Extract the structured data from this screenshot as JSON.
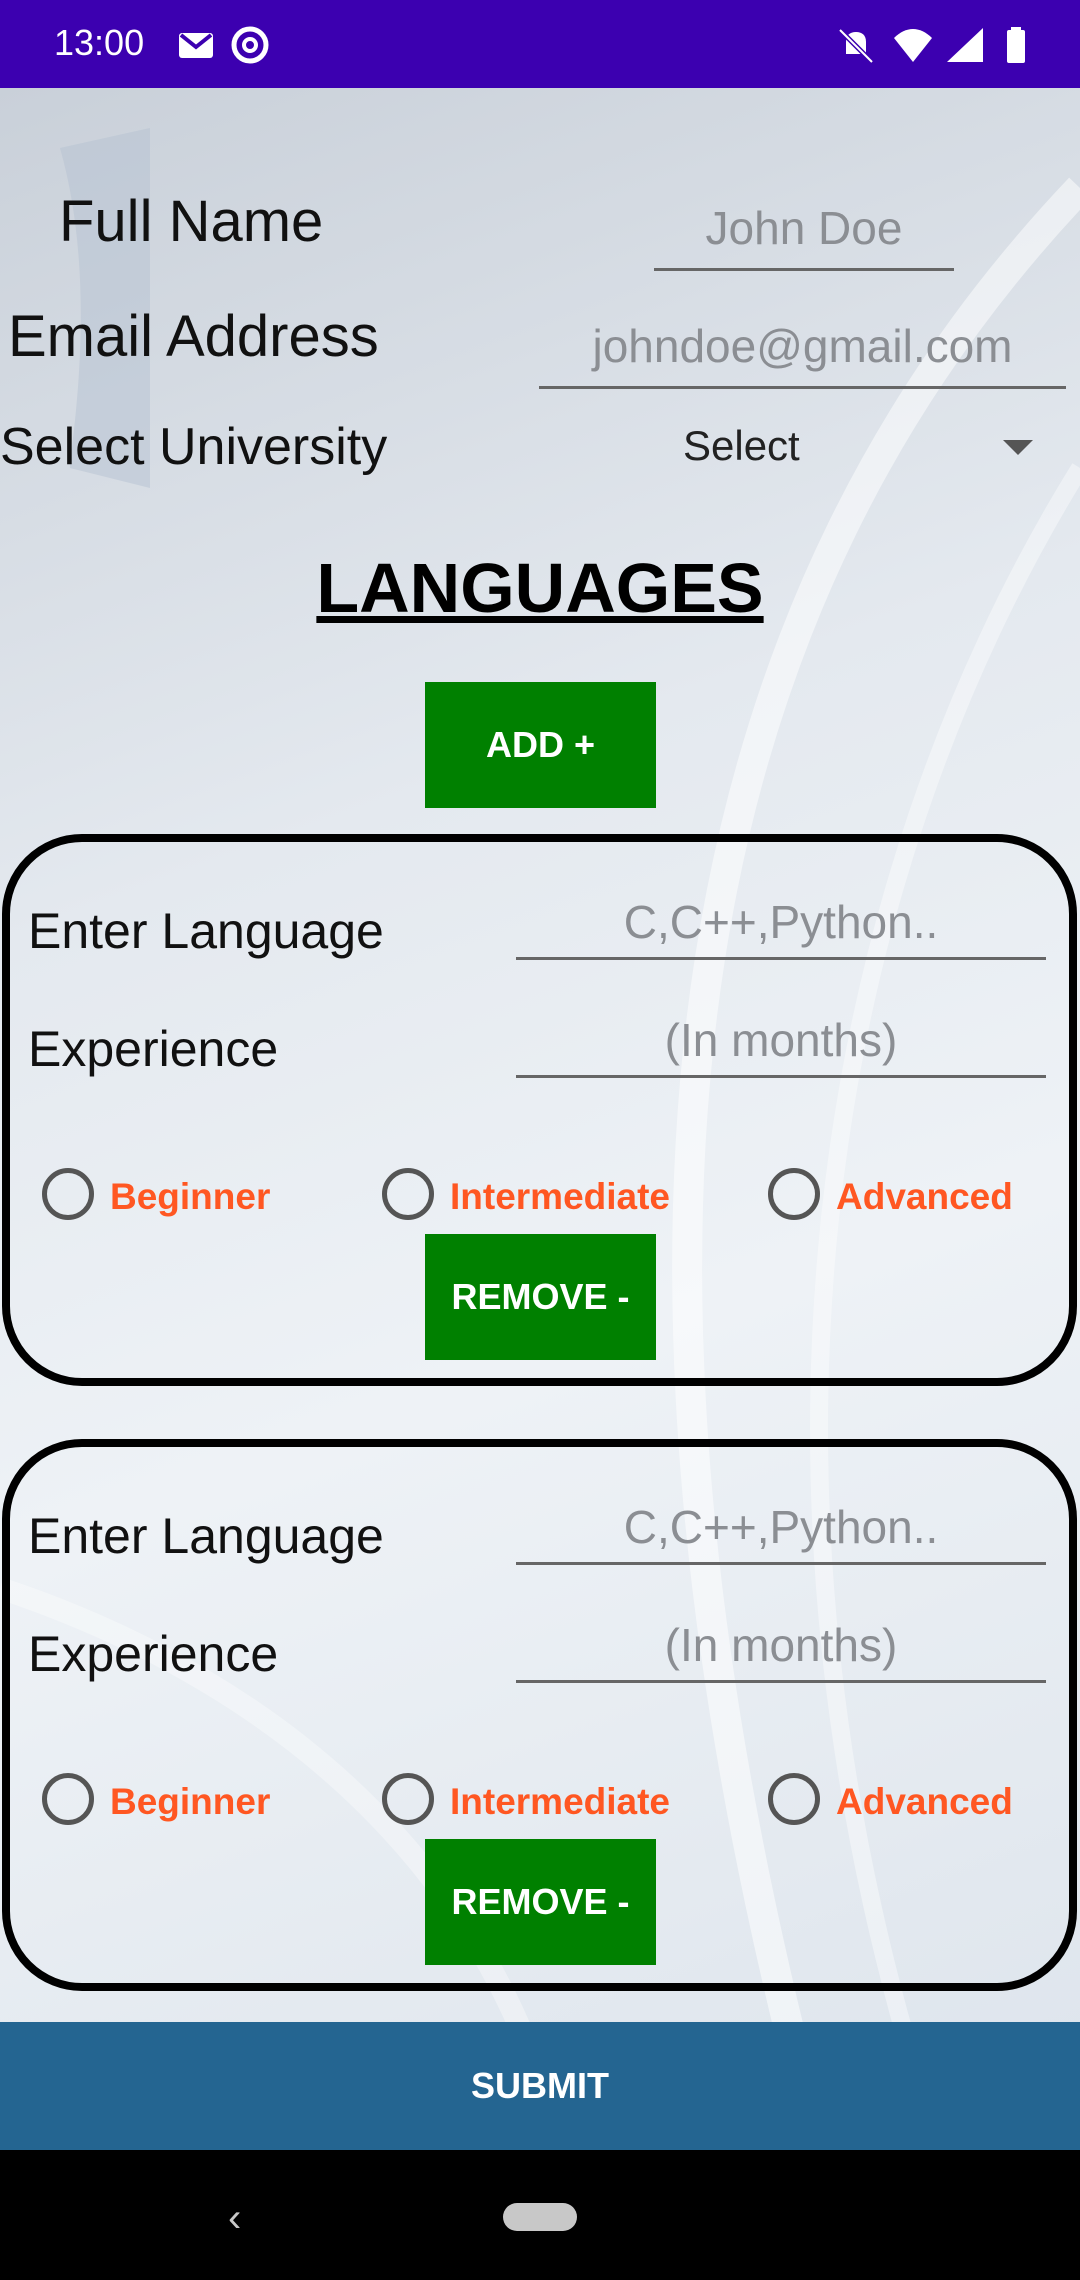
{
  "status_bar": {
    "time": "13:00"
  },
  "form": {
    "full_name": {
      "label": "Full Name",
      "placeholder": "John Doe"
    },
    "email": {
      "label": "Email Address",
      "placeholder": "johndoe@gmail.com"
    },
    "university": {
      "label": "Select University",
      "selected": "Select"
    }
  },
  "languages_title": "LANGUAGES",
  "add_button": "ADD +",
  "cards": [
    {
      "language_label": "Enter Language",
      "language_placeholder": "C,C++,Python..",
      "experience_label": "Experience",
      "experience_placeholder": "(In months)",
      "levels": [
        "Beginner",
        "Intermediate",
        "Advanced"
      ],
      "remove_button": "REMOVE -"
    },
    {
      "language_label": "Enter Language",
      "language_placeholder": "C,C++,Python..",
      "experience_label": "Experience",
      "experience_placeholder": "(In months)",
      "levels": [
        "Beginner",
        "Intermediate",
        "Advanced"
      ],
      "remove_button": "REMOVE -"
    }
  ],
  "submit_button": "SUBMIT",
  "nav": {
    "back_glyph": "‹"
  },
  "colors": {
    "status_bar": "#3c00b0",
    "green_button": "#008000",
    "submit": "#246591",
    "level_text": "#ff5722"
  }
}
